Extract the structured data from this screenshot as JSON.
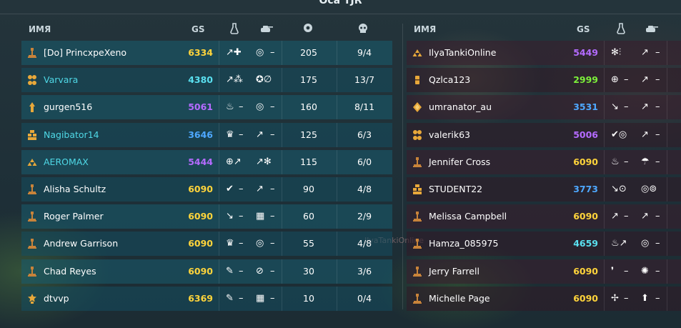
{
  "title": "Оса TJR",
  "headers": {
    "name": "ИМЯ",
    "gs": "GS",
    "turret_icon": "flask-icon",
    "hull_icon": "tank-icon",
    "score_icon": "gear-icon",
    "kd_icon": "skull-icon"
  },
  "watermark": "IlyaTankiOnline",
  "left_team": [
    {
      "rank": "bronze-single",
      "name": "[Do] PrincxpeXeno",
      "gs": "6334",
      "gs_color": "yellow",
      "friend": false,
      "turret": "↗✚",
      "turret_extra": "",
      "hull": "◎",
      "hull_extra": "–",
      "score": "205",
      "kd": "9/4"
    },
    {
      "rank": "gold-cluster",
      "name": "Varvara",
      "gs": "4380",
      "gs_color": "cyan",
      "friend": true,
      "turret": "↗⁂",
      "turret_extra": "",
      "hull": "✪∅",
      "hull_extra": "",
      "score": "175",
      "kd": "13/7"
    },
    {
      "rank": "gold-arrow",
      "name": "gurgen516",
      "gs": "5061",
      "gs_color": "purple",
      "friend": false,
      "turret": "♨",
      "turret_extra": "–",
      "hull": "◎",
      "hull_extra": "–",
      "score": "160",
      "kd": "8/11"
    },
    {
      "rank": "gold-blocks",
      "name": "Nagibator14",
      "gs": "3646",
      "gs_color": "blue",
      "friend": true,
      "turret": "♛",
      "turret_extra": "–",
      "hull": "↗",
      "hull_extra": "–",
      "score": "125",
      "kd": "6/3"
    },
    {
      "rank": "gold-triangle",
      "name": "AEROMAX",
      "gs": "5444",
      "gs_color": "purple",
      "friend": true,
      "turret": "⊕↗",
      "turret_extra": "",
      "hull": "↗✻",
      "hull_extra": "",
      "score": "115",
      "kd": "6/0"
    },
    {
      "rank": "bronze-single",
      "name": "Alisha Schultz",
      "gs": "6090",
      "gs_color": "yellow",
      "friend": false,
      "turret": "✔",
      "turret_extra": "–",
      "hull": "↗",
      "hull_extra": "–",
      "score": "90",
      "kd": "4/8"
    },
    {
      "rank": "bronze-single",
      "name": "Roger Palmer",
      "gs": "6090",
      "gs_color": "yellow",
      "friend": false,
      "turret": "↘",
      "turret_extra": "–",
      "hull": "▦",
      "hull_extra": "–",
      "score": "60",
      "kd": "2/9"
    },
    {
      "rank": "bronze-single",
      "name": "Andrew Garrison",
      "gs": "6090",
      "gs_color": "yellow",
      "friend": false,
      "turret": "♛",
      "turret_extra": "–",
      "hull": "◎",
      "hull_extra": "–",
      "score": "55",
      "kd": "4/8"
    },
    {
      "rank": "bronze-single",
      "name": "Chad Reyes",
      "gs": "6090",
      "gs_color": "yellow",
      "friend": false,
      "turret": "✎",
      "turret_extra": "–",
      "hull": "⊘",
      "hull_extra": "–",
      "score": "30",
      "kd": "3/6"
    },
    {
      "rank": "gold-star",
      "name": "dtvvp",
      "gs": "6369",
      "gs_color": "yellow",
      "friend": false,
      "turret": "✎",
      "turret_extra": "–",
      "hull": "▦",
      "hull_extra": "–",
      "score": "10",
      "kd": "0/4"
    }
  ],
  "right_team": [
    {
      "rank": "gold-triangle",
      "name": "IlyaTankiOnline",
      "gs": "5449",
      "gs_color": "purple",
      "turret": "✻⫶",
      "hull": "↗",
      "hull_extra": "–"
    },
    {
      "rank": "gold-bar",
      "name": "Qzlca123",
      "gs": "2999",
      "gs_color": "green",
      "turret": "⊕",
      "turret_extra": "–",
      "hull": "↗",
      "hull_extra": "–"
    },
    {
      "rank": "gold-diamond",
      "name": "umranator_au",
      "gs": "3531",
      "gs_color": "blue",
      "turret": "↘",
      "turret_extra": "–",
      "hull": "↗",
      "hull_extra": "–"
    },
    {
      "rank": "gold-cluster",
      "name": "valerik63",
      "gs": "5006",
      "gs_color": "purple",
      "turret": "✔◎",
      "hull": "↗",
      "hull_extra": "–"
    },
    {
      "rank": "bronze-single",
      "name": "Jennifer Cross",
      "gs": "6090",
      "gs_color": "yellow",
      "turret": "♨",
      "turret_extra": "–",
      "hull": "☂",
      "hull_extra": "–"
    },
    {
      "rank": "gold-blocks",
      "name": "STUDENT22",
      "gs": "3773",
      "gs_color": "blue",
      "turret": "↘⊙",
      "hull": "◎⊚"
    },
    {
      "rank": "bronze-single",
      "name": "Melissa Campbell",
      "gs": "6090",
      "gs_color": "yellow",
      "turret": "↗",
      "turret_extra": "–",
      "hull": "↗",
      "hull_extra": "–"
    },
    {
      "rank": "bronze-single",
      "name": "Hamza_085975",
      "gs": "4659",
      "gs_color": "cyan",
      "turret": "♨↗",
      "hull": "◎",
      "hull_extra": "–"
    },
    {
      "rank": "bronze-single",
      "name": "Jerry Farrell",
      "gs": "6090",
      "gs_color": "yellow",
      "turret": "❜",
      "turret_extra": "–",
      "hull": "✺",
      "hull_extra": "–"
    },
    {
      "rank": "bronze-single",
      "name": "Michelle Page",
      "gs": "6090",
      "gs_color": "yellow",
      "turret": "✢",
      "turret_extra": "–",
      "hull": "⬆",
      "hull_extra": "–"
    }
  ],
  "colors": {
    "yellow": "#ffd43b",
    "purple": "#b46bff",
    "cyan": "#5ae0f0",
    "blue": "#4ea8ff",
    "green": "#7cf03a",
    "friend_name": "#4fd8e6"
  }
}
